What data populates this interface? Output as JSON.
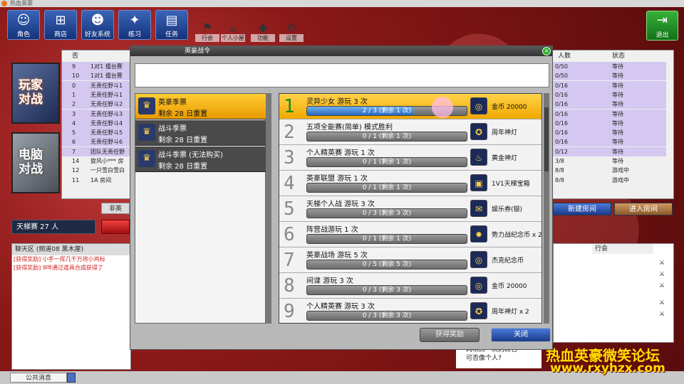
{
  "titlebar": {
    "title": "热血英豪"
  },
  "nav": [
    {
      "label": "角色",
      "icon": "person-icon"
    },
    {
      "label": "商店",
      "icon": "cart-icon"
    },
    {
      "label": "好友系统",
      "icon": "friends-icon"
    },
    {
      "label": "练习",
      "icon": "practice-icon"
    },
    {
      "label": "任务",
      "icon": "task-icon"
    }
  ],
  "small_nav": [
    {
      "label": "行会",
      "icon": "guild-icon"
    },
    {
      "label": "个人小屋",
      "icon": "house-icon"
    },
    {
      "label": "功能",
      "icon": "function-icon"
    },
    {
      "label": "设置",
      "icon": "gear-icon"
    }
  ],
  "exit_label": "退出",
  "modes": {
    "player": "玩家\n对战",
    "computer": "电脑\n对战"
  },
  "room_table": {
    "headers": {
      "num": "否",
      "players": "人数",
      "status": "状态"
    },
    "rows": [
      {
        "num": "9",
        "name": "1对1 擂台赛",
        "players": "0/50",
        "status": "等待",
        "hl": true
      },
      {
        "num": "10",
        "name": "1对1 擂台赛",
        "players": "0/50",
        "status": "等待",
        "hl": true
      },
      {
        "num": "0",
        "name": "无责任野斗1",
        "players": "0/16",
        "status": "等待",
        "hl": true
      },
      {
        "num": "1",
        "name": "无责任野斗1",
        "players": "0/16",
        "status": "等待",
        "hl": true
      },
      {
        "num": "2",
        "name": "无责任野斗2",
        "players": "0/16",
        "status": "等待",
        "hl": true
      },
      {
        "num": "3",
        "name": "无责任野斗3",
        "players": "0/16",
        "status": "等待",
        "hl": true
      },
      {
        "num": "4",
        "name": "无责任野斗4",
        "players": "0/16",
        "status": "等待",
        "hl": true
      },
      {
        "num": "5",
        "name": "无责任野斗5",
        "players": "0/16",
        "status": "等待",
        "hl": true
      },
      {
        "num": "6",
        "name": "无责任野斗6",
        "players": "0/16",
        "status": "等待",
        "hl": true
      },
      {
        "num": "7",
        "name": "团队无责任野",
        "players": "0/12",
        "status": "等待",
        "hl": true
      },
      {
        "num": "14",
        "name": "旋风小*** 房",
        "players": "3/8",
        "status": "等待",
        "hl": false
      },
      {
        "num": "12",
        "name": "一只雪白雪白",
        "players": "8/8",
        "status": "游戏中",
        "hl": false
      },
      {
        "num": "11",
        "name": "1A 房间",
        "players": "8/8",
        "status": "游戏中",
        "hl": false
      }
    ]
  },
  "ladder": {
    "label": "天梯赛 27 人"
  },
  "non_room_tab": "非英",
  "room_buttons": {
    "new_room": "新建房间",
    "enter_room": "进入房间"
  },
  "chat": {
    "title": "聊天区 (频道08 黑木崖)",
    "lines": [
      "[获得奖励] 小手一挥几千万将小鸡标",
      "[获得奖励] 9咩通过道具合成获得了"
    ]
  },
  "public_msg": "公共消息",
  "guild_tab": "行会",
  "news": [
    "两块四一次的改名",
    "可否像个人?"
  ],
  "watermark": {
    "line1": "热血英豪微笑论坛",
    "line2": "www.rxyhzx.com"
  },
  "dialog": {
    "title": "英豪战令",
    "close_icon": "close-icon",
    "tickets": [
      {
        "name": "英豪季票",
        "reset": "剩余 28 日重置",
        "selected": true
      },
      {
        "name": "战斗季票",
        "reset": "剩余 28 日重置",
        "selected": false
      },
      {
        "name": "战斗季票 (无法购买)",
        "reset": "剩余 28 日重置",
        "selected": false
      }
    ],
    "tasks": [
      {
        "num": "1",
        "desc": "灵异少女 游玩 3 次",
        "progress": "2 / 3 (剩余 1 次)",
        "fraction": 0.667,
        "reward": "金币 20000",
        "reward_icon": "coin-icon",
        "selected": true
      },
      {
        "num": "2",
        "desc": "五项全能赛(简单) 模式胜利",
        "progress": "0 / 1 (剩余 1 次)",
        "fraction": 0,
        "reward": "周年神灯",
        "reward_icon": "lamp-icon",
        "selected": false
      },
      {
        "num": "3",
        "desc": "个人精英赛 游玩 1 次",
        "progress": "0 / 1 (剩余 1 次)",
        "fraction": 0,
        "reward": "黄金神灯",
        "reward_icon": "golden-lamp-icon",
        "selected": false
      },
      {
        "num": "4",
        "desc": "英豪联盟 游玩 1 次",
        "progress": "0 / 1 (剩余 1 次)",
        "fraction": 0,
        "reward": "1V1天梯宝箱",
        "reward_icon": "chest-icon",
        "selected": false
      },
      {
        "num": "5",
        "desc": "天梯个人战 游玩 3 次",
        "progress": "0 / 3 (剩余 3 次)",
        "fraction": 0,
        "reward": "娱乐券(银)",
        "reward_icon": "ticket-icon",
        "selected": false
      },
      {
        "num": "6",
        "desc": "阵营战游玩 1 次",
        "progress": "0 / 1 (剩余 1 次)",
        "fraction": 0,
        "reward": "势力战纪念币 x 2",
        "reward_icon": "medal-icon",
        "selected": false
      },
      {
        "num": "7",
        "desc": "英豪战场 游玩 5 次",
        "progress": "0 / 5 (剩余 5 次)",
        "fraction": 0,
        "reward": "杰克纪念币",
        "reward_icon": "coin-icon",
        "selected": false
      },
      {
        "num": "8",
        "desc": "间谍 游玩 3 次",
        "progress": "0 / 3 (剩余 3 次)",
        "fraction": 0,
        "reward": "金币 20000",
        "reward_icon": "coin-icon",
        "selected": false
      },
      {
        "num": "9",
        "desc": "个人精英赛 游玩 3 次",
        "progress": "0 / 3 (剩余 3 次)",
        "fraction": 0,
        "reward": "周年神灯 x 2",
        "reward_icon": "lamp-icon",
        "selected": false
      }
    ],
    "buttons": {
      "claim": "获得奖励",
      "close": "关闭"
    }
  }
}
